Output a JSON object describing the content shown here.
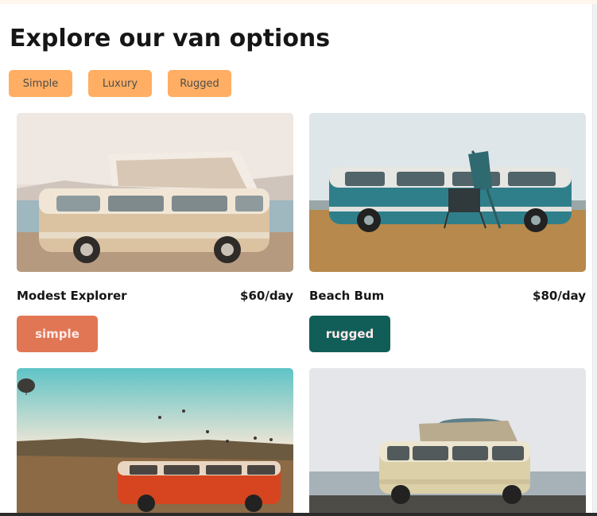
{
  "page": {
    "title": "Explore our van options"
  },
  "filters": [
    {
      "label": "Simple"
    },
    {
      "label": "Luxury"
    },
    {
      "label": "Rugged"
    }
  ],
  "vans": [
    {
      "name": "Modest Explorer",
      "price": "$60/day",
      "type": "simple",
      "type_color": "#e17654"
    },
    {
      "name": "Beach Bum",
      "price": "$80/day",
      "type": "rugged",
      "type_color": "#115e59"
    },
    {
      "name": "",
      "price": "",
      "type": ""
    },
    {
      "name": "",
      "price": "",
      "type": ""
    }
  ],
  "colors": {
    "filter_bg": "#ffae63",
    "simple": "#e17654",
    "rugged": "#115e59"
  }
}
